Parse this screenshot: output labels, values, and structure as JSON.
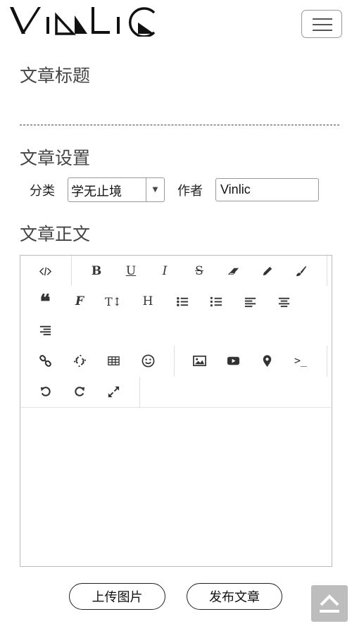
{
  "header": {
    "logo_text": "Vinlic",
    "menu_icon": "hamburger-icon"
  },
  "article": {
    "title_label": "文章标题",
    "title_value": "",
    "settings_label": "文章设置",
    "category_label": "分类",
    "category_value": "学无止境",
    "author_label": "作者",
    "author_value": "Vinlic",
    "body_label": "文章正文"
  },
  "toolbar": {
    "icons": [
      "code-icon",
      "bold-icon",
      "underline-icon",
      "italic-icon",
      "strikethrough-icon",
      "eraser-icon",
      "pencil-icon",
      "brush-icon",
      "quote-icon",
      "font-icon",
      "text-height-icon",
      "heading-icon",
      "list-ul-icon",
      "list-ol-icon",
      "align-left-icon",
      "align-center-icon",
      "align-right-icon",
      "link-icon",
      "unlink-icon",
      "table-icon",
      "emoji-icon",
      "image-icon",
      "video-icon",
      "map-marker-icon",
      "terminal-icon",
      "undo-icon",
      "redo-icon",
      "fullscreen-icon"
    ],
    "bold": "B",
    "underline": "U",
    "italic": "I",
    "strike": "S",
    "font": "F",
    "text_height": "T↕",
    "heading": "H",
    "terminal": ">_"
  },
  "actions": {
    "upload_label": "上传图片",
    "publish_label": "发布文章"
  },
  "back_to_top_icon": "chevron-up-icon"
}
